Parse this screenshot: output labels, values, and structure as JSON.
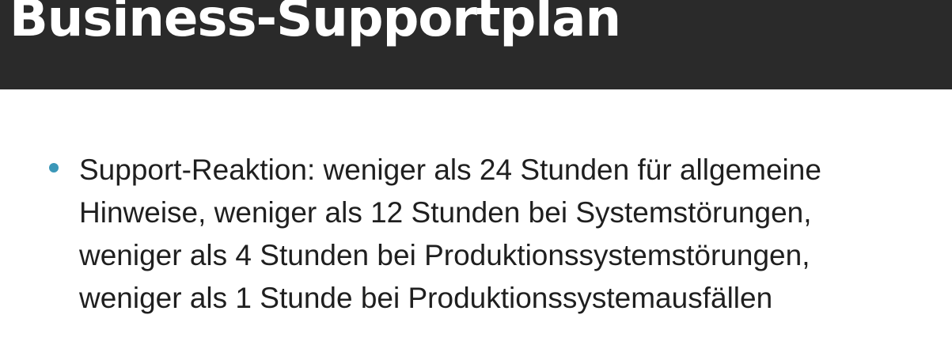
{
  "header": {
    "title": "Business-Supportplan"
  },
  "content": {
    "bullets": [
      {
        "lines": [
          "Support-Reaktion: weniger als 24 Stunden für allgemeine",
          "Hinweise, weniger als 12 Stunden bei Systemstörungen,",
          "weniger als 4 Stunden bei Produktionssystemstörungen,",
          "weniger als 1 Stunde bei Produktionssystemausfällen"
        ]
      }
    ]
  },
  "colors": {
    "header_background": "#2a2a2a",
    "bullet_accent": "#3b97b8"
  }
}
